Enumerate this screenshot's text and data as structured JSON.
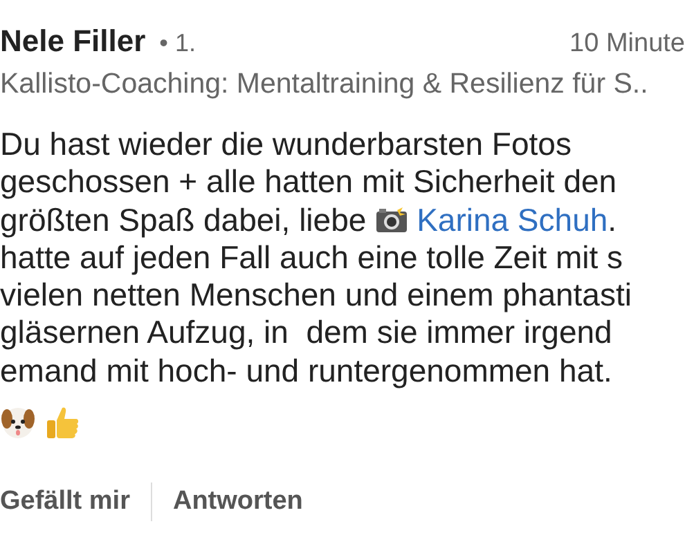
{
  "comment": {
    "author": "Nele Filler",
    "connection": "• 1.",
    "time": "10 Minute",
    "headline": "Kallisto-Coaching: Mentaltraining & Resilienz für S..",
    "body": [
      [
        {
          "kind": "text",
          "text": "Du hast wieder die wunderbarsten Fotos"
        }
      ],
      [
        {
          "kind": "text",
          "text": "geschossen + alle hatten mit Sicherheit den"
        }
      ],
      [
        {
          "kind": "text",
          "text": "größten Spaß dabei, liebe "
        },
        {
          "kind": "camera"
        },
        {
          "kind": "mention",
          "text": "Karina Schuh"
        },
        {
          "kind": "text",
          "text": "."
        }
      ],
      [
        {
          "kind": "text",
          "text": "hatte auf jeden Fall auch eine tolle Zeit mit s"
        }
      ],
      [
        {
          "kind": "text",
          "text": "vielen netten Menschen und einem phantasti"
        }
      ],
      [
        {
          "kind": "text",
          "text": "gläsernen Aufzug, in  dem sie immer irgend"
        }
      ],
      [
        {
          "kind": "text",
          "text": "emand mit hoch- und runtergenommen hat."
        }
      ],
      [
        {
          "kind": "dog"
        },
        {
          "kind": "thumbs"
        }
      ]
    ],
    "actions": [
      "Gefällt mir",
      "Antworten"
    ]
  }
}
